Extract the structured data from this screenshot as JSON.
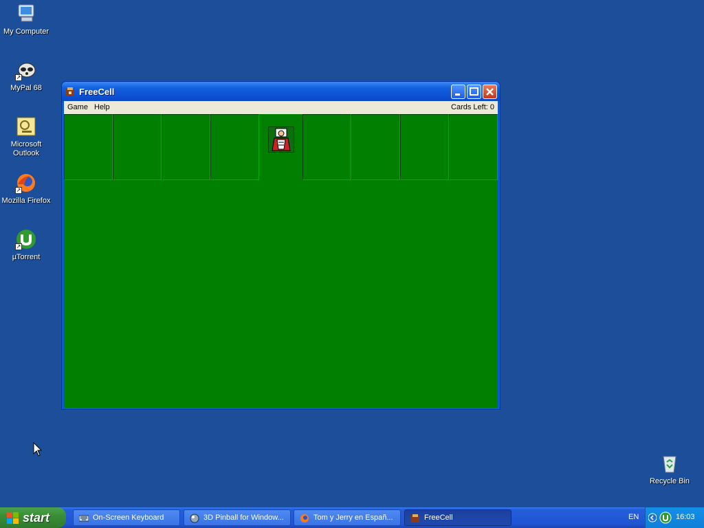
{
  "desktop": {
    "icons": [
      {
        "label": "My Computer"
      },
      {
        "label": "MyPal 68"
      },
      {
        "label": "Microsoft Outlook"
      },
      {
        "label": "Mozilla Firefox"
      },
      {
        "label": "µTorrent"
      },
      {
        "label": "Recycle Bin"
      }
    ]
  },
  "window": {
    "title": "FreeCell",
    "menu": {
      "game": "Game",
      "help": "Help"
    },
    "cards_left": "Cards Left: 0",
    "board_color": "#007f00"
  },
  "taskbar": {
    "start_label": "start",
    "tasks": [
      {
        "label": "On-Screen Keyboard"
      },
      {
        "label": "3D Pinball for Window..."
      },
      {
        "label": "Tom y Jerry en Españ..."
      },
      {
        "label": "FreeCell"
      }
    ],
    "language": "EN",
    "clock": "16:03"
  }
}
